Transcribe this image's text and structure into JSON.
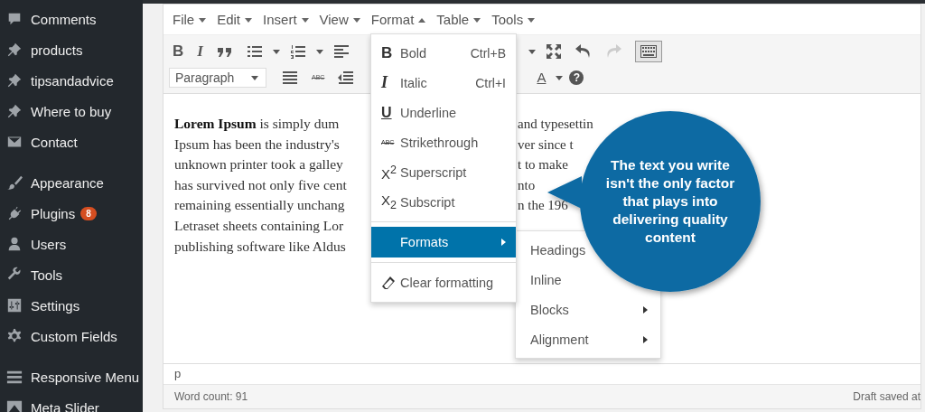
{
  "sidebar": {
    "sections": [
      {
        "items": [
          {
            "label": "Comments"
          },
          {
            "label": "products"
          },
          {
            "label": "tipsandadvice"
          },
          {
            "label": "Where to buy"
          },
          {
            "label": "Contact"
          }
        ]
      },
      {
        "items": [
          {
            "label": "Appearance"
          },
          {
            "label": "Plugins",
            "badge": "8"
          },
          {
            "label": "Users"
          },
          {
            "label": "Tools"
          },
          {
            "label": "Settings"
          },
          {
            "label": "Custom Fields"
          }
        ]
      },
      {
        "items": [
          {
            "label": "Responsive Menu"
          },
          {
            "label": "Meta Slider"
          }
        ]
      }
    ]
  },
  "menubar": [
    {
      "label": "File",
      "expanded": false
    },
    {
      "label": "Edit",
      "expanded": false
    },
    {
      "label": "Insert",
      "expanded": false
    },
    {
      "label": "View",
      "expanded": false
    },
    {
      "label": "Format",
      "expanded": true
    },
    {
      "label": "Table",
      "expanded": false
    },
    {
      "label": "Tools",
      "expanded": false
    }
  ],
  "toolbar": {
    "bold_glyph": "B",
    "italic_glyph": "I",
    "redo_disabled": true,
    "toggle_active": true,
    "format_select": "Paragraph",
    "strike_glyph": "ABC",
    "color_glyph": "A",
    "help_glyph": "?"
  },
  "content": {
    "lines": [
      {
        "left": "**Lorem Ipsum** is simply dum",
        "right": "and typesettin"
      },
      {
        "left": "Ipsum has been the industry's",
        "right": "ver since t"
      },
      {
        "left": "unknown printer took a galley",
        "right": "t to make"
      },
      {
        "left": "has survived not only five cent",
        "right": "nto"
      },
      {
        "left": "remaining essentially unchang",
        "right": "n the 196"
      },
      {
        "left": "Letraset sheets containing Lor"
      },
      {
        "left": "publishing software like Aldus"
      }
    ]
  },
  "format_menu": {
    "items": [
      {
        "kind": "item",
        "glyph": "B",
        "label": "Bold",
        "shortcut": "Ctrl+B"
      },
      {
        "kind": "item",
        "glyph": "I",
        "label": "Italic",
        "shortcut": "Ctrl+I"
      },
      {
        "kind": "item",
        "glyph": "U",
        "label": "Underline"
      },
      {
        "kind": "item",
        "glyph": "ABC",
        "label": "Strikethrough"
      },
      {
        "kind": "item",
        "glyph": "X$^{2}$",
        "label": "Superscript"
      },
      {
        "kind": "item",
        "glyph": "X$_{2}$",
        "label": "Subscript"
      },
      {
        "kind": "separator"
      },
      {
        "kind": "submenu",
        "label": "Formats",
        "selected": true
      },
      {
        "kind": "separator"
      },
      {
        "kind": "item",
        "label": "Clear formatting"
      }
    ]
  },
  "formats_submenu": {
    "items": [
      {
        "label": "Headings"
      },
      {
        "label": "Inline"
      },
      {
        "label": "Blocks",
        "has_submenu": true
      },
      {
        "label": "Alignment",
        "has_submenu": true
      }
    ]
  },
  "callout": {
    "text": "The text you write isn't the only factor that plays into delivering quality content"
  },
  "path_bar": "p",
  "status_bar": {
    "word_count": "Word count: 91",
    "draft": "Draft saved at"
  }
}
